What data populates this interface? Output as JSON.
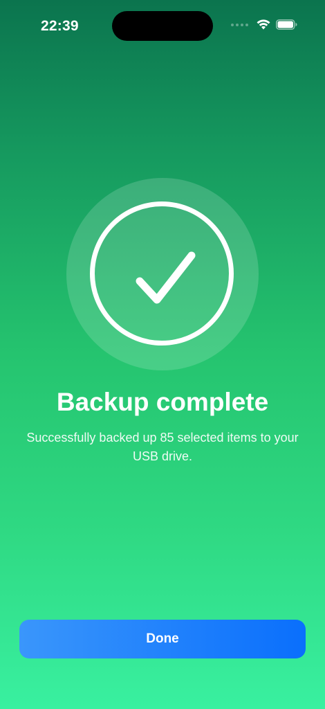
{
  "status_bar": {
    "time": "22:39",
    "icons": [
      "signal-dots-icon",
      "wifi-icon",
      "battery-icon"
    ]
  },
  "success": {
    "icon": "checkmark-circle-icon",
    "title": "Backup complete",
    "message": "Successfully backed up 85 selected items to your USB drive."
  },
  "actions": {
    "done_label": "Done"
  },
  "colors": {
    "background_top": "#0b744e",
    "background_bottom": "#39f0a0",
    "button_start": "#3a96fb",
    "button_end": "#0a6ffc",
    "text": "#ffffff"
  }
}
